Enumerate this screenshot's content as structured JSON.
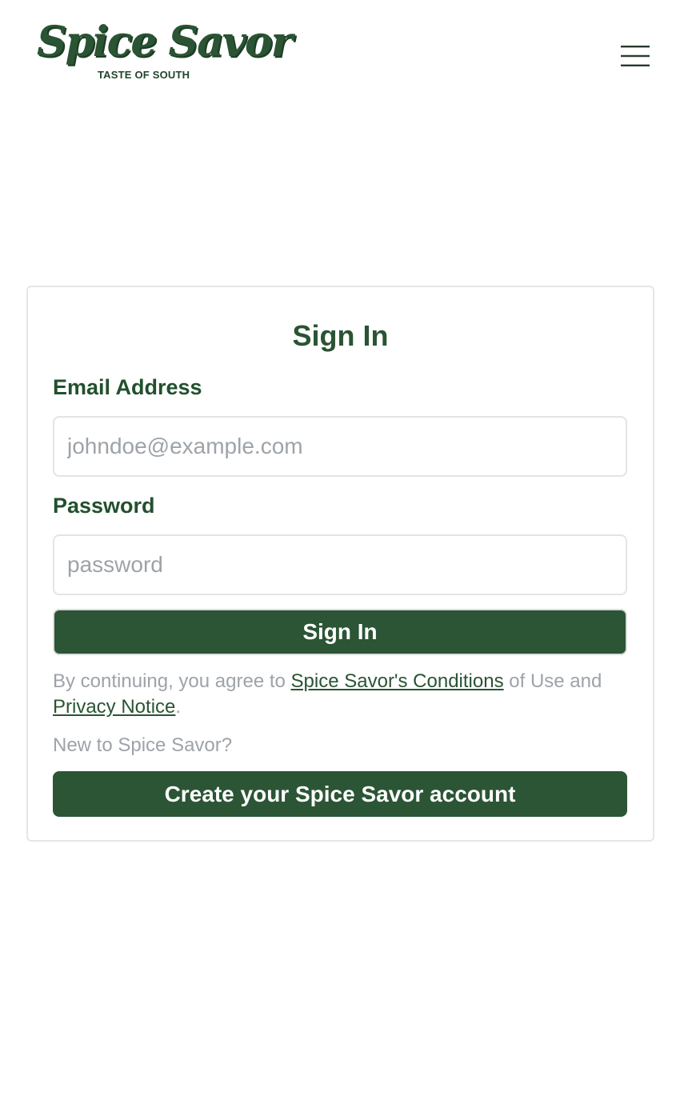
{
  "header": {
    "logo_name": "Spice Savor",
    "logo_tagline": "TASTE OF SOUTH",
    "menu_icon": "hamburger-menu-icon"
  },
  "signin": {
    "title": "Sign In",
    "email_label": "Email Address",
    "email_placeholder": "johndoe@example.com",
    "email_value": "",
    "password_label": "Password",
    "password_placeholder": "password",
    "password_value": "",
    "submit_label": "Sign In",
    "terms_prefix": "By continuing, you agree to ",
    "terms_link": "Spice Savor's Conditions",
    "terms_middle": " of Use and ",
    "privacy_link": "Privacy Notice",
    "terms_suffix": ".",
    "new_user_text": "New to Spice Savor?",
    "create_account_label": "Create your Spice Savor account"
  },
  "colors": {
    "brand_green": "#2b5535",
    "muted_text": "#9ea3a8",
    "border": "#e4e4e4"
  }
}
